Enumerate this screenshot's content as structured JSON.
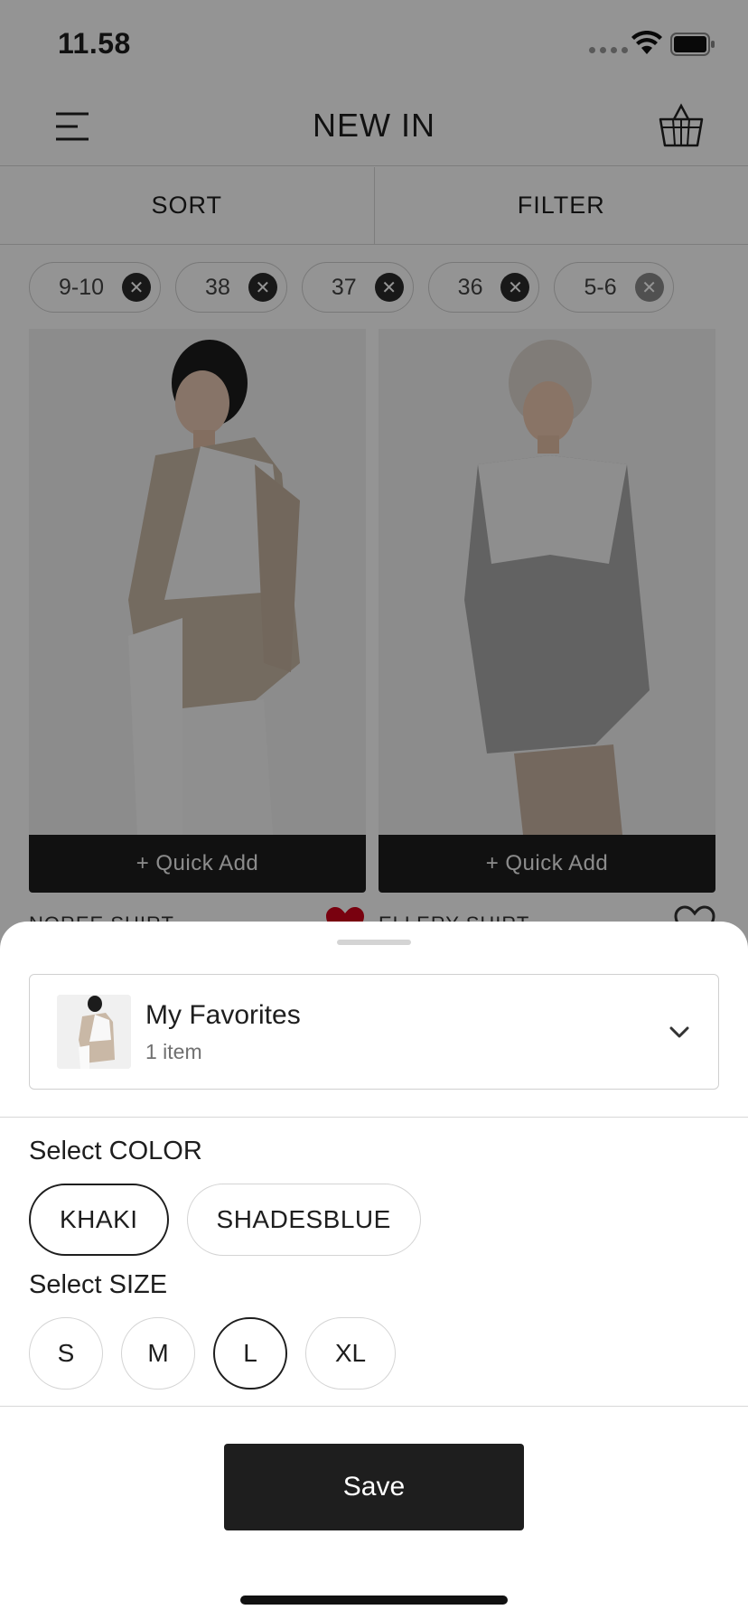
{
  "status_bar": {
    "time": "11.58"
  },
  "header": {
    "title": "NEW IN",
    "menu_icon": "hamburger-menu-icon",
    "basket_icon": "basket-icon"
  },
  "sort_filter": {
    "sort_label": "SORT",
    "filter_label": "FILTER"
  },
  "active_filters": [
    {
      "label": "9-10"
    },
    {
      "label": "38"
    },
    {
      "label": "37"
    },
    {
      "label": "36"
    },
    {
      "label": "5-6"
    }
  ],
  "products": [
    {
      "name": "NOREE SHIRT",
      "quick_add": "+ Quick Add",
      "favorited": true
    },
    {
      "name": "ELLERY SHIRT",
      "quick_add": "+ Quick Add",
      "favorited": false
    }
  ],
  "sheet": {
    "collection": {
      "name": "My Favorites",
      "count": "1 item"
    },
    "color_label": "Select COLOR",
    "colors": [
      {
        "label": "KHAKI",
        "selected": true
      },
      {
        "label": "SHADESBLUE",
        "selected": false
      }
    ],
    "size_label": "Select SIZE",
    "sizes": [
      {
        "label": "S",
        "selected": false
      },
      {
        "label": "M",
        "selected": false
      },
      {
        "label": "L",
        "selected": true
      },
      {
        "label": "XL",
        "selected": false
      }
    ],
    "save_label": "Save"
  },
  "colors": {
    "accent": "#1e1e1e",
    "heart": "#d0021b",
    "overlay": "rgba(0,0,0,0.42)"
  }
}
